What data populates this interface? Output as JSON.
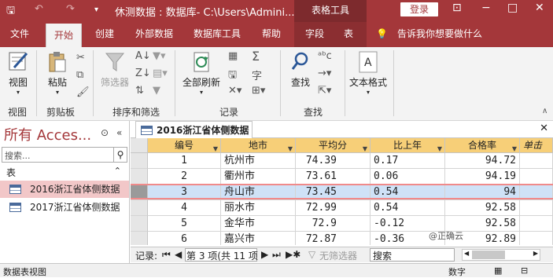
{
  "titlebar": {
    "title": "休测数据 : 数据库- C:\\Users\\Admini...",
    "context_tab": "表格工具",
    "signin": "登录",
    "minimize": "−",
    "restore": "□",
    "close": "✕"
  },
  "tabs": [
    "文件",
    "开始",
    "创建",
    "外部数据",
    "数据库工具",
    "帮助",
    "字段",
    "表"
  ],
  "tell_me": "告诉我你想要做什么",
  "ribbon": {
    "view_label": "视图",
    "paste_label": "粘贴",
    "filter_label": "筛选器",
    "refresh_label": "全部刷新",
    "find_label": "查找",
    "textformat_label": "文本格式",
    "groups": [
      "视图",
      "剪贴板",
      "排序和筛选",
      "记录",
      "查找"
    ]
  },
  "nav": {
    "title": "所有 Acces...",
    "search_placeholder": "搜索...",
    "group": "表",
    "items": [
      "2016浙江省体侧数据",
      "2017浙江省体侧数据"
    ]
  },
  "doc_tab": "2016浙江省体侧数据",
  "table": {
    "columns": [
      "编号",
      "地市",
      "平均分",
      "比上年",
      "合格率",
      "单击"
    ],
    "rows": [
      [
        "1",
        "杭州市",
        "74.39",
        "0.17",
        "94.72"
      ],
      [
        "2",
        "衢州市",
        "73.61",
        "0.06",
        "94.19"
      ],
      [
        "3",
        "舟山市",
        "73.45",
        "0.54",
        "94"
      ],
      [
        "4",
        "丽水市",
        "72.99",
        "0.54",
        "92.58"
      ],
      [
        "5",
        "金华市",
        "72.9",
        "-0.12",
        "92.58"
      ],
      [
        "6",
        "嘉兴市",
        "72.87",
        "-0.36",
        "92.89"
      ]
    ],
    "current_row": 2
  },
  "watermark": "@正确云",
  "recnav": {
    "label": "记录:",
    "position": "第 3 项(共 11 项",
    "filter": "无筛选器",
    "search": "搜索"
  },
  "status": {
    "left": "数据表视图",
    "right": "数字"
  },
  "colors": {
    "accent": "#a4373a",
    "header": "#f7cf78",
    "selected": "#f2c7c8",
    "current": "#cfe2f7"
  }
}
